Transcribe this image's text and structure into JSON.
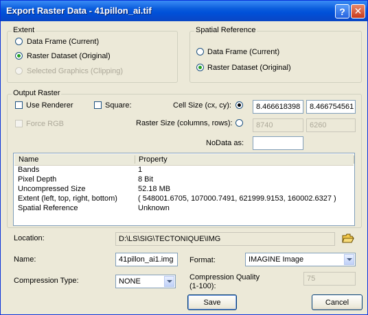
{
  "window": {
    "title": "Export Raster Data - 41pillon_ai.tif",
    "help_glyph": "?",
    "close_glyph": "✕"
  },
  "extent": {
    "legend": "Extent",
    "options": [
      {
        "label": "Data Frame (Current)",
        "checked": false,
        "enabled": true
      },
      {
        "label": "Raster Dataset (Original)",
        "checked": true,
        "enabled": true
      },
      {
        "label": "Selected Graphics (Clipping)",
        "checked": false,
        "enabled": false
      }
    ]
  },
  "spatial_reference": {
    "legend": "Spatial Reference",
    "options": [
      {
        "label": "Data Frame (Current)",
        "checked": false
      },
      {
        "label": "Raster Dataset (Original)",
        "checked": true
      }
    ]
  },
  "output_raster": {
    "legend": "Output Raster",
    "use_renderer_label": "Use Renderer",
    "use_renderer_checked": false,
    "square_label": "Square:",
    "square_checked": false,
    "force_rgb_label": "Force RGB",
    "cell_size_label": "Cell Size (cx, cy):",
    "cell_size_selected": true,
    "cell_cx": "8.466618398",
    "cell_cy": "8.466754561",
    "raster_size_label": "Raster Size (columns, rows):",
    "raster_size_selected": false,
    "columns": "8740",
    "rows": "6260",
    "nodata_label": "NoData as:",
    "nodata_value": ""
  },
  "properties_table": {
    "headers": [
      "Name",
      "Property"
    ],
    "rows": [
      [
        "Bands",
        "1"
      ],
      [
        "Pixel Depth",
        "8 Bit"
      ],
      [
        "Uncompressed Size",
        "52.18 MB"
      ],
      [
        "Extent (left, top, right, bottom)",
        "( 548001.6705, 107000.7491, 621999.9153, 160002.6327 )"
      ],
      [
        "Spatial Reference",
        "Unknown"
      ]
    ]
  },
  "location": {
    "label": "Location:",
    "value": "D:\\LS\\SIG\\TECTONIQUE\\IMG"
  },
  "name": {
    "label": "Name:",
    "value": "41pillon_ai1.img"
  },
  "format": {
    "label": "Format:",
    "value": "IMAGINE Image"
  },
  "compression": {
    "type_label": "Compression Type:",
    "type_value": "NONE",
    "quality_label_line1": "Compression Quality",
    "quality_label_line2": "(1-100):",
    "quality_value": "75"
  },
  "buttons": {
    "save": "Save",
    "cancel": "Cancel"
  },
  "colors": {
    "title_bar": "#0a5cdc",
    "dialog_bg": "#ece9d8",
    "radio_checked": "#21a121"
  }
}
